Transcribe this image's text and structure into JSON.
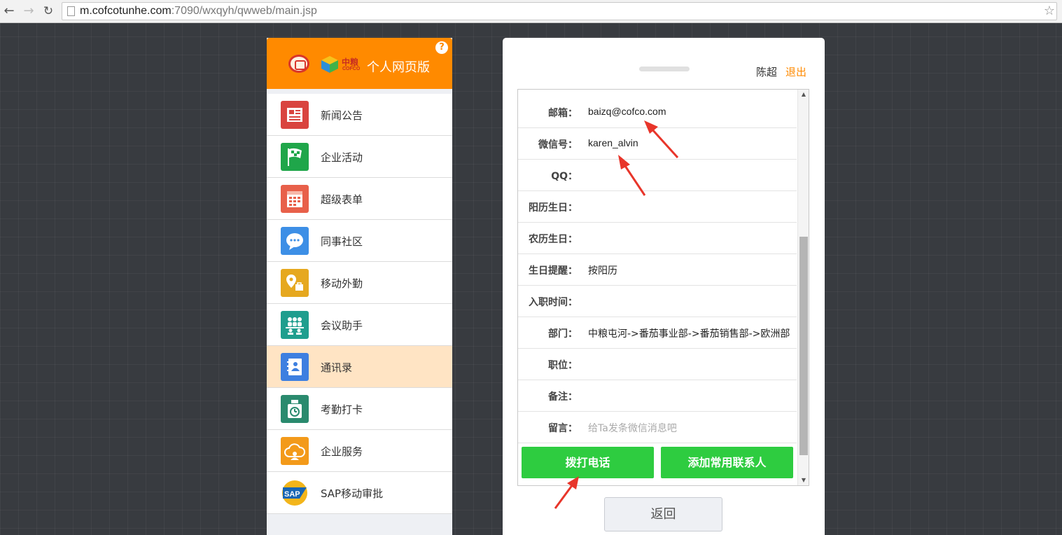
{
  "browser": {
    "url_host": "m.cofcotunhe.com",
    "url_rest": ":7090/wxqyh/qwweb/main.jsp",
    "back_glyph": "←",
    "forward_glyph": "→",
    "reload_glyph": "↻",
    "star_glyph": "☆"
  },
  "header": {
    "title": "个人网页版",
    "logo_cn": "中粮",
    "logo_en": "COFCO",
    "help_glyph": "?"
  },
  "menu": {
    "items": [
      {
        "label": "新闻公告",
        "icon": "news-icon",
        "color": "#d9443f"
      },
      {
        "label": "企业活动",
        "icon": "flag-icon",
        "color": "#1fa64a"
      },
      {
        "label": "超级表单",
        "icon": "form-icon",
        "color": "#e8604a"
      },
      {
        "label": "同事社区",
        "icon": "chat-bubble-icon",
        "color": "#3d8fe6"
      },
      {
        "label": "移动外勤",
        "icon": "location-pin-icon",
        "color": "#e6a81f"
      },
      {
        "label": "会议助手",
        "icon": "meeting-people-icon",
        "color": "#1f9e8e"
      },
      {
        "label": "通讯录",
        "icon": "contacts-book-icon",
        "color": "#3d7fe0"
      },
      {
        "label": "考勤打卡",
        "icon": "clock-in-icon",
        "color": "#2a8a6e"
      },
      {
        "label": "企业服务",
        "icon": "cloud-service-icon",
        "color": "#f39a1a"
      },
      {
        "label": "SAP移动审批",
        "icon": "sap-logo-icon",
        "color": "#f3b51a"
      }
    ],
    "active_index": 6
  },
  "user": {
    "name": "陈超",
    "logout": "退出"
  },
  "detail": {
    "rows": [
      {
        "label": "邮箱：",
        "value": "baizq@cofco.com"
      },
      {
        "label": "微信号：",
        "value": "karen_alvin"
      },
      {
        "label": "QQ：",
        "value": ""
      },
      {
        "label": "阳历生日：",
        "value": ""
      },
      {
        "label": "农历生日：",
        "value": ""
      },
      {
        "label": "生日提醒：",
        "value": "按阳历"
      },
      {
        "label": "入职时间：",
        "value": ""
      },
      {
        "label": "部门：",
        "value": "中粮屯河->番茄事业部->番茄销售部->欧洲部"
      },
      {
        "label": "职位：",
        "value": ""
      },
      {
        "label": "备注：",
        "value": ""
      },
      {
        "label": "留言：",
        "placeholder": "给Ta发条微信消息吧"
      }
    ],
    "call_button": "拨打电话",
    "add_contact_button": "添加常用联系人",
    "scroll_up_glyph": "▲",
    "scroll_down_glyph": "▼"
  },
  "back_button": "返回",
  "colors": {
    "accent_orange": "#ff8a00",
    "action_green": "#2ecc40",
    "annotation_red": "#e8352a"
  }
}
